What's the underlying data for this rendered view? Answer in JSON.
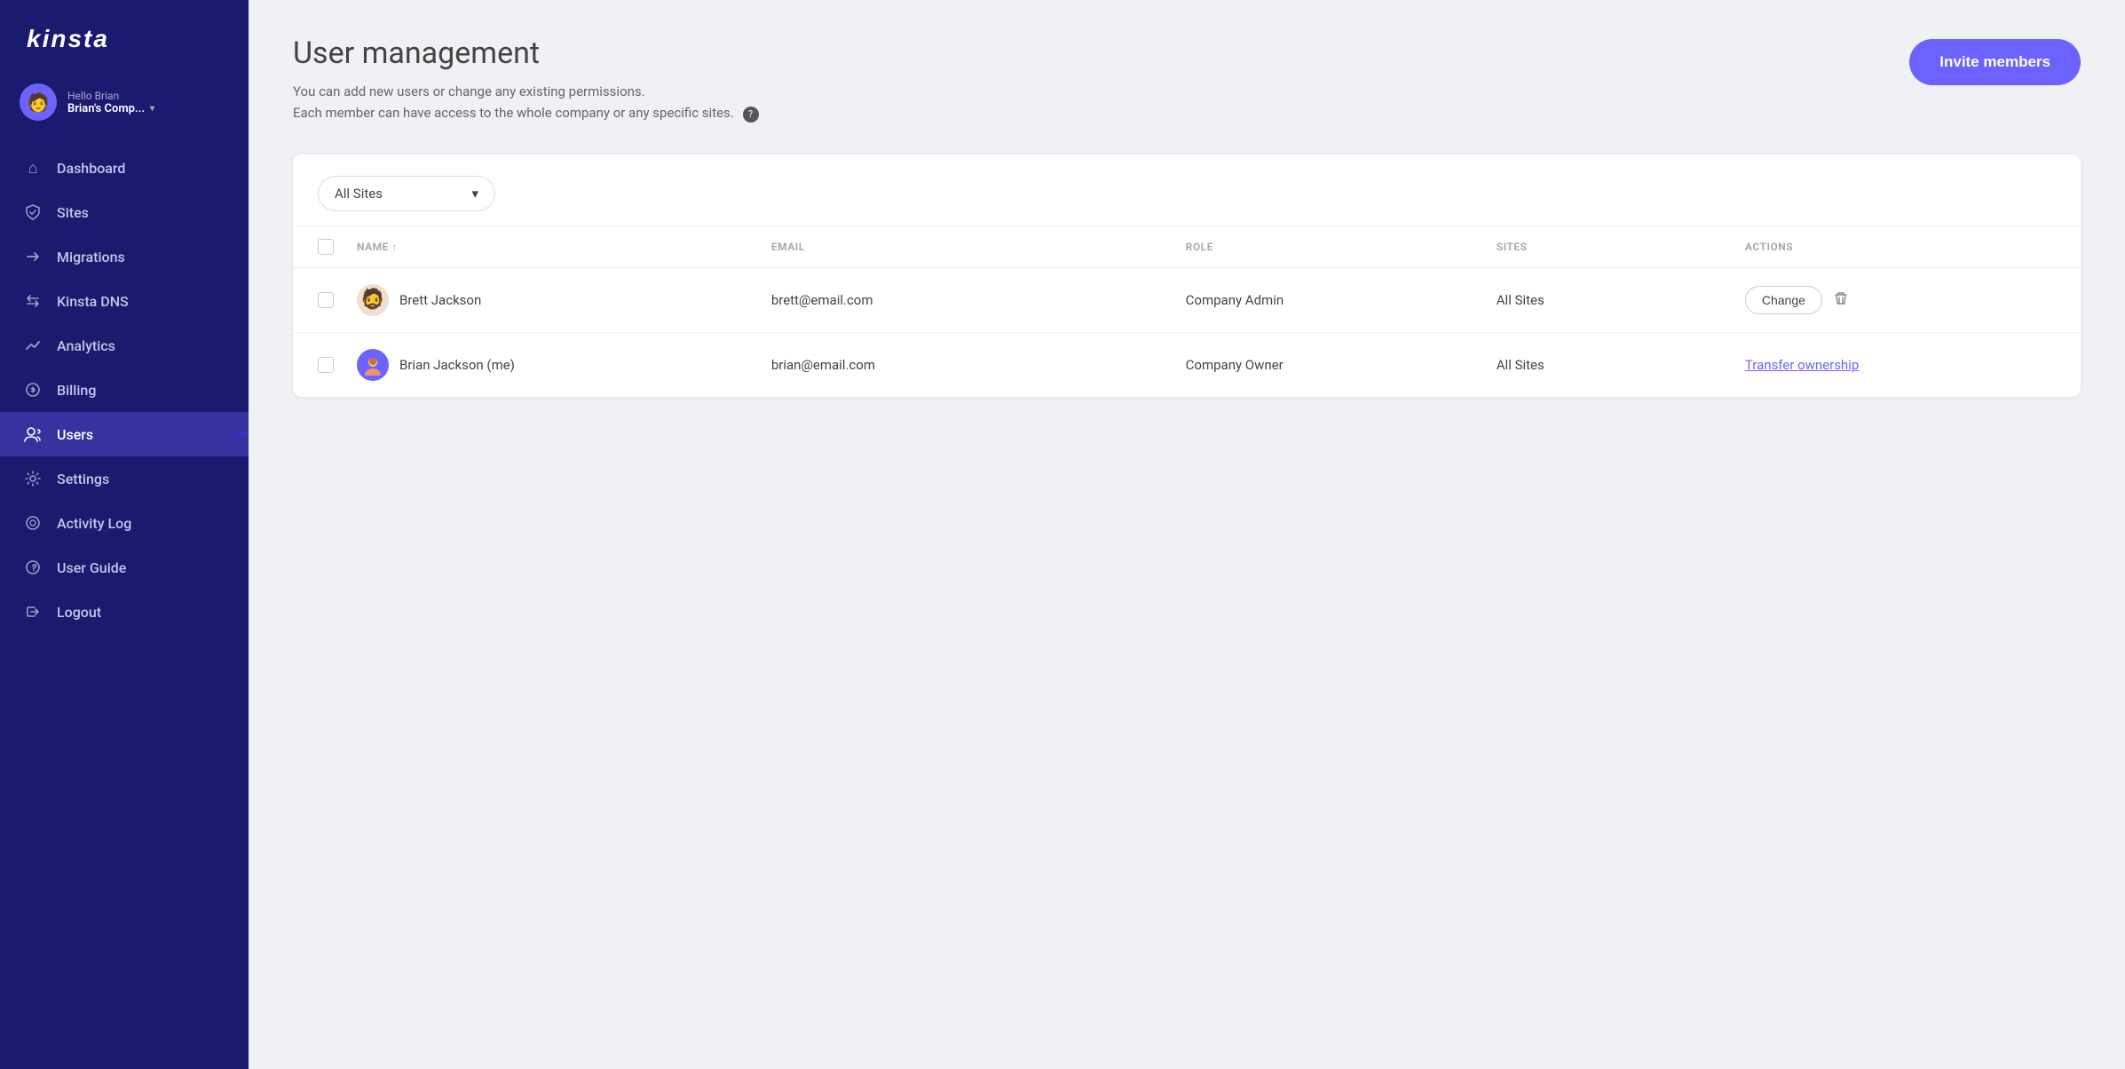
{
  "sidebar": {
    "logo": "kinsta",
    "user": {
      "greeting": "Hello Brian",
      "company": "Brian's Comp...",
      "avatar_emoji": "🧑"
    },
    "nav": [
      {
        "id": "dashboard",
        "label": "Dashboard",
        "icon": "⌂",
        "active": false
      },
      {
        "id": "sites",
        "label": "Sites",
        "icon": "◈",
        "active": false
      },
      {
        "id": "migrations",
        "label": "Migrations",
        "icon": "➤",
        "active": false
      },
      {
        "id": "kinsta-dns",
        "label": "Kinsta DNS",
        "icon": "⟿",
        "active": false
      },
      {
        "id": "analytics",
        "label": "Analytics",
        "icon": "↗",
        "active": false
      },
      {
        "id": "billing",
        "label": "Billing",
        "icon": "⊖",
        "active": false
      },
      {
        "id": "users",
        "label": "Users",
        "icon": "👤+",
        "active": true
      },
      {
        "id": "settings",
        "label": "Settings",
        "icon": "⚙",
        "active": false
      },
      {
        "id": "activity-log",
        "label": "Activity Log",
        "icon": "👁",
        "active": false
      },
      {
        "id": "user-guide",
        "label": "User Guide",
        "icon": "❓",
        "active": false
      },
      {
        "id": "logout",
        "label": "Logout",
        "icon": "⇥",
        "active": false
      }
    ]
  },
  "page": {
    "title": "User management",
    "description_line1": "You can add new users or change any existing permissions.",
    "description_line2": "Each member can have access to the whole company or any specific sites.",
    "invite_button": "Invite members"
  },
  "filter": {
    "label": "All Sites",
    "icon": "chevron-down"
  },
  "table": {
    "columns": [
      {
        "id": "checkbox",
        "label": ""
      },
      {
        "id": "name",
        "label": "NAME ↑"
      },
      {
        "id": "email",
        "label": "EMAIL"
      },
      {
        "id": "role",
        "label": "ROLE"
      },
      {
        "id": "sites",
        "label": "SITES"
      },
      {
        "id": "actions",
        "label": "ACTIONS"
      }
    ],
    "rows": [
      {
        "id": "brett",
        "name": "Brett Jackson",
        "email": "brett@email.com",
        "role": "Company Admin",
        "sites": "All Sites",
        "avatar_emoji": "🧔",
        "action_type": "change",
        "action_label": "Change"
      },
      {
        "id": "brian",
        "name": "Brian Jackson (me)",
        "email": "brian@email.com",
        "role": "Company Owner",
        "sites": "All Sites",
        "avatar_emoji": "👤",
        "action_type": "transfer",
        "action_label": "Transfer ownership"
      }
    ]
  }
}
